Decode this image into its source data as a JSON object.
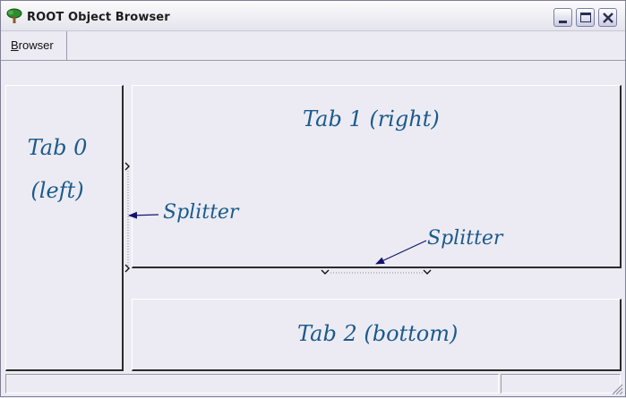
{
  "window": {
    "title": "ROOT Object Browser",
    "app_icon": "tree-icon",
    "controls": [
      "minimize-icon",
      "maximize-icon",
      "close-icon"
    ]
  },
  "menubar": {
    "browser_mnemonic": "B",
    "browser_rest": "rowser"
  },
  "tabs": {
    "left": {
      "line1": "Tab 0",
      "line2": "(left)"
    },
    "right": {
      "label": "Tab 1 (right)"
    },
    "bottom": {
      "label": "Tab 2 (bottom)"
    }
  },
  "annotations": {
    "vertical_splitter": "Splitter",
    "horizontal_splitter": "Splitter"
  },
  "colors": {
    "annotation_blue": "#1b5a8c",
    "arrow_navy": "#14146e",
    "window_bg": "#ecebf3"
  }
}
